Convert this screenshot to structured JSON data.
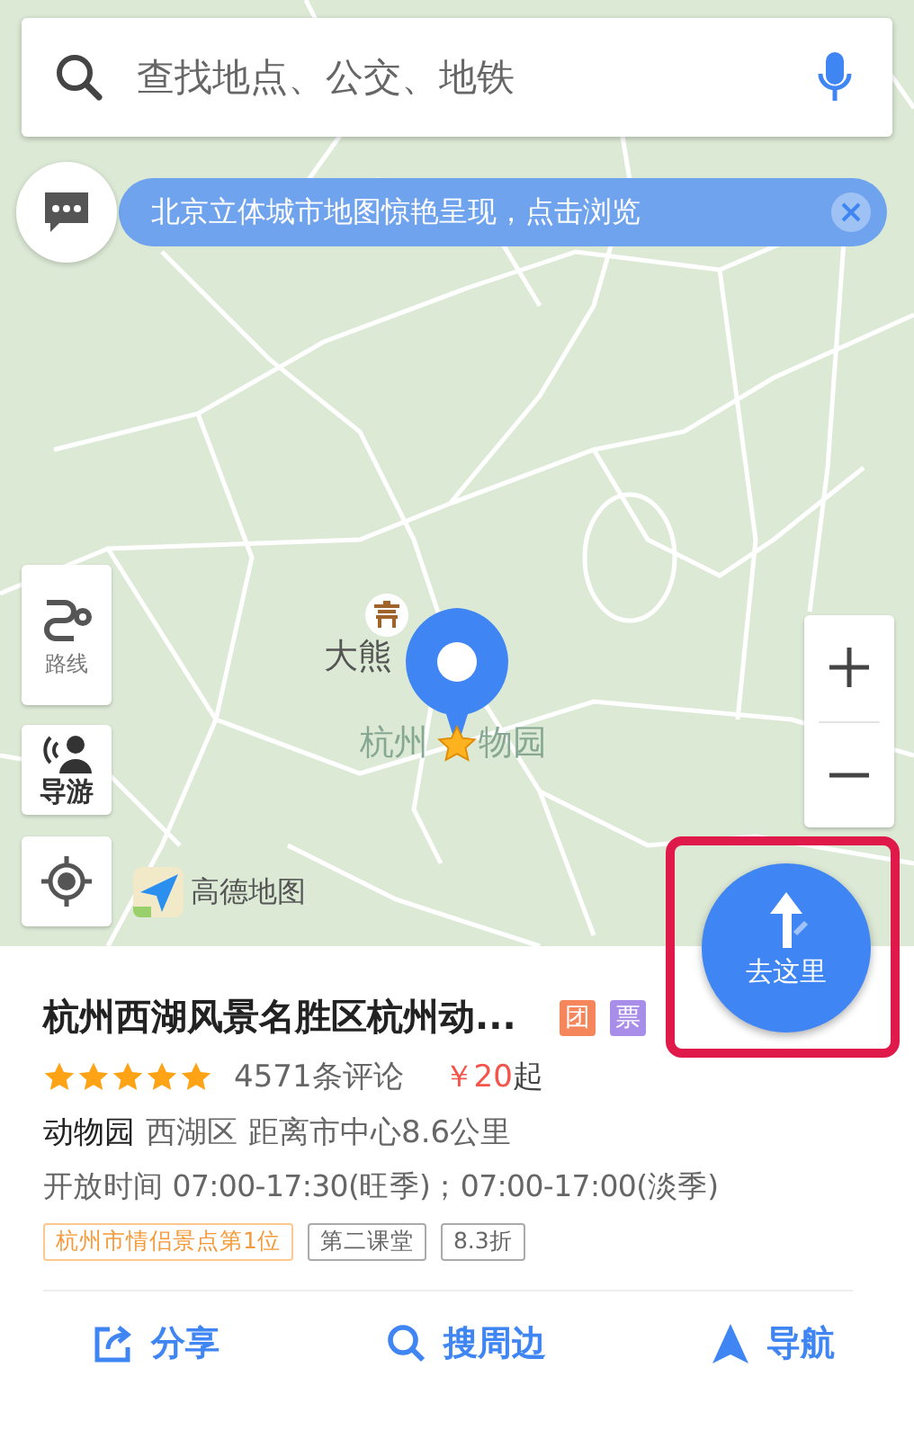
{
  "search": {
    "placeholder": "查找地点、公交、地铁"
  },
  "banner": {
    "text": "北京立体城市地图惊艳呈现，点击浏览"
  },
  "map": {
    "controls": [
      {
        "kind": "route",
        "label": "路线"
      },
      {
        "kind": "guide",
        "label": "导游"
      },
      {
        "kind": "locate"
      }
    ],
    "logo": "高德地图",
    "labels": [
      {
        "kind": "poi",
        "text": "大熊"
      },
      {
        "kind": "place",
        "text": "杭州"
      },
      {
        "kind": "place",
        "text": "物园"
      }
    ],
    "go_button": {
      "label": "去这里",
      "highlighted": true
    }
  },
  "place": {
    "title": "杭州西湖风景名胜区杭州动...",
    "badges": [
      {
        "text": "团",
        "color": "#f5865c"
      },
      {
        "text": "票",
        "color": "#a98ee9"
      }
    ],
    "stars": 5,
    "reviews": "4571条评论",
    "price": "￥20",
    "price_suffix": "起",
    "category": "动物园",
    "district": "西湖区",
    "distance": "距离市中心8.6公里",
    "hours": "开放时间 07:00-17:30(旺季)；07:00-17:00(淡季)",
    "tags": [
      {
        "text": "杭州市情侣景点第1位",
        "kind": "highlight"
      },
      {
        "text": "第二课堂",
        "kind": "plain"
      },
      {
        "text": "8.3折",
        "kind": "plain"
      }
    ],
    "actions": [
      {
        "kind": "share",
        "label": "分享"
      },
      {
        "kind": "search",
        "label": "搜周边"
      },
      {
        "kind": "navigate",
        "label": "导航"
      }
    ]
  }
}
